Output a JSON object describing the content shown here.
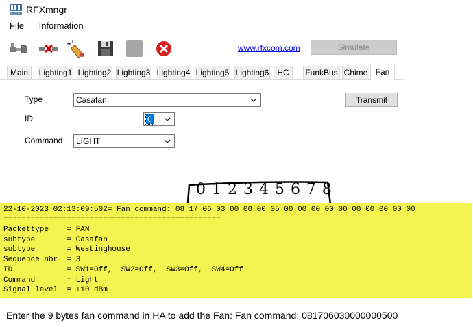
{
  "window": {
    "title": "RFXmngr"
  },
  "menu": {
    "items": [
      "File",
      "Information"
    ]
  },
  "toolbar": {
    "icons": [
      "connect-plug-icon",
      "disconnect-icon",
      "magic-wand-icon",
      "save-disk-icon",
      "stop-square-icon",
      "close-x-icon"
    ],
    "link": "www.rfxcom.com",
    "simulate_label": "Simulate"
  },
  "tabs": [
    "Main",
    "Lighting1",
    "Lighting2",
    "Lighting3",
    "Lighting4",
    "Lighting5",
    "Lighting6",
    "HC",
    "FunkBus",
    "Chime",
    "Fan"
  ],
  "active_tab": "Fan",
  "form": {
    "type_label": "Type",
    "type_value": "Casafan",
    "id_label": "ID",
    "id_value": "0",
    "command_label": "Command",
    "command_value": "LIGHT",
    "transmit_label": "Transmit"
  },
  "handwriting": "0 1 2 3 4 5 6 7 8",
  "log": {
    "lines": [
      "22-10-2023 02:13:09:502= Fan command: 08 17 06 03 00 00 00 05 00 00 00 00 00 00 00 00 00 00",
      "================================================",
      "Packettype    = FAN",
      "subtype       = Casafan",
      "subtype       = Westinghouse",
      "Sequence nbr  = 3",
      "ID            = SW1=Off,  SW2=Off,  SW3=Off,  SW4=Off",
      "Command       = Light",
      "Signal level  = +10 dBm"
    ]
  },
  "caption": "Enter the 9 bytes fan command in HA to add the Fan: Fan command: 081706030000000500"
}
